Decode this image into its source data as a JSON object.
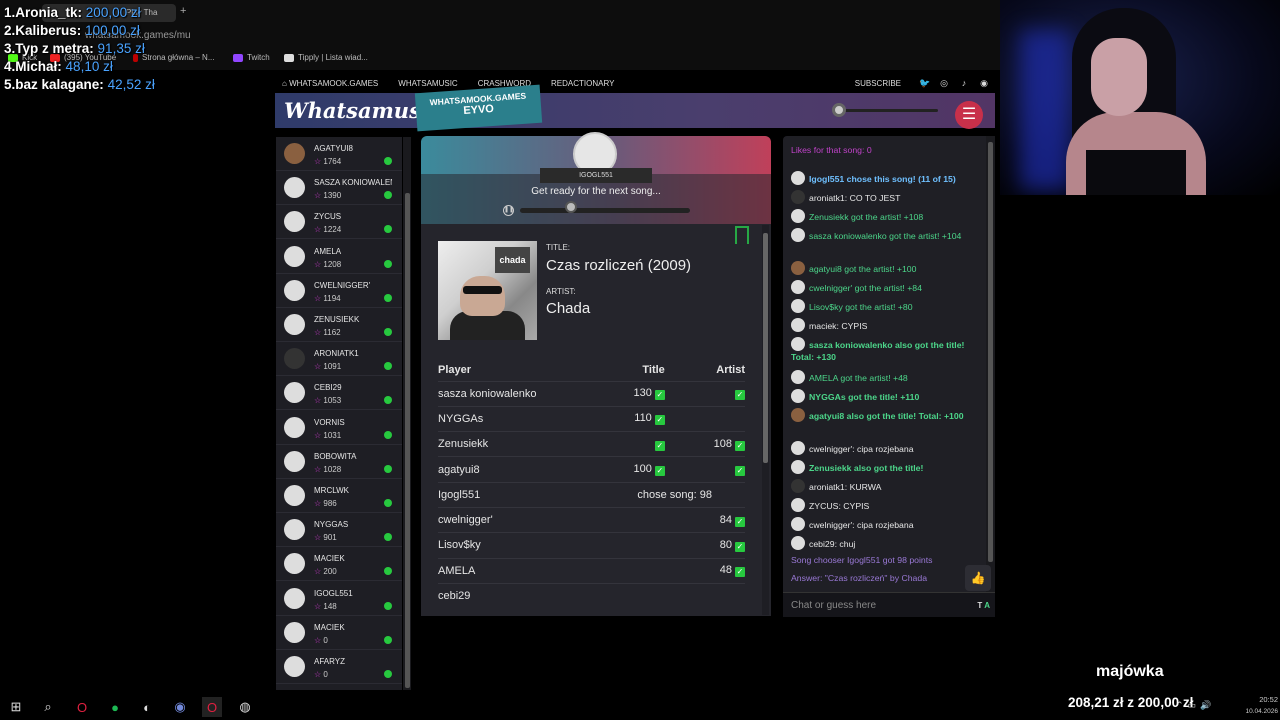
{
  "browser": {
    "tab_label": "Play Tha",
    "url": "whatsamook.games/mu",
    "bookmarks": [
      "Kick",
      "(395) YouTube",
      "Strona główna – N...",
      "Twitch",
      "Tipply | Lista wiad..."
    ]
  },
  "donations": [
    {
      "rank": "1.",
      "name": "Aronia_tk:",
      "amount": "200,00 zł"
    },
    {
      "rank": "2.",
      "name": "Kaliberus:",
      "amount": "100,00 zł"
    },
    {
      "rank": "3.",
      "name": "Typ z metra:",
      "amount": "91,35 zł"
    },
    {
      "rank": "4.",
      "name": "Michał:",
      "amount": "48,10 zł"
    },
    {
      "rank": "5.",
      "name": "baz kalagane:",
      "amount": "42,52 zł"
    }
  ],
  "sitenav": {
    "home": "WHATSAMOOK.GAMES",
    "links": [
      "WHATSAMUSIC",
      "CRASHWORD",
      "REDACTIONARY"
    ],
    "subscribe": "SUBSCRIBE",
    "social_icons": [
      "twitter-icon",
      "instagram-icon",
      "tiktok-icon",
      "discord-icon"
    ]
  },
  "header": {
    "logo": "Whatsamusic",
    "room_site": "WHATSAMOOK.GAMES",
    "room_code": "EYVO",
    "volume": 0.0
  },
  "players": [
    {
      "name": "AGATYUI8",
      "score": "1764"
    },
    {
      "name": "SASZA KONIOWALENKO",
      "score": "1390"
    },
    {
      "name": "ZYCUS",
      "score": "1224"
    },
    {
      "name": "AMELA",
      "score": "1208"
    },
    {
      "name": "CWELNIGGER'",
      "score": "1194"
    },
    {
      "name": "ZENUSIEKK",
      "score": "1162"
    },
    {
      "name": "ARONIATK1",
      "score": "1091"
    },
    {
      "name": "CEBI29",
      "score": "1053"
    },
    {
      "name": "VORNIS",
      "score": "1031"
    },
    {
      "name": "BOBOWITA",
      "score": "1028"
    },
    {
      "name": "MRCLWK",
      "score": "986"
    },
    {
      "name": "NYGGAS",
      "score": "901"
    },
    {
      "name": "MACIEK",
      "score": "200"
    },
    {
      "name": "IGOGL551",
      "score": "148"
    },
    {
      "name": "MACIEK",
      "score": "0"
    },
    {
      "name": "AFARYZ",
      "score": "0"
    }
  ],
  "round": {
    "chooser": "IGOGL551",
    "status": "Get ready for the next song...",
    "progress": 0.3,
    "title_label": "TITLE:",
    "title": "Czas rozliczeń (2009)",
    "artist_label": "ARTIST:",
    "artist": "Chada",
    "cover_text": "chada"
  },
  "scoreboard": {
    "headers": [
      "Player",
      "Title",
      "Artist"
    ],
    "rows": [
      {
        "player": "sasza koniowalenko",
        "title": "130",
        "title_ok": true,
        "artist": "",
        "artist_ok": true
      },
      {
        "player": "NYGGAs",
        "title": "110",
        "title_ok": true,
        "artist": "",
        "artist_ok": false
      },
      {
        "player": "Zenusiekk",
        "title": "",
        "title_ok": true,
        "artist": "108",
        "artist_ok": true
      },
      {
        "player": "agatyui8",
        "title": "100",
        "title_ok": true,
        "artist": "",
        "artist_ok": true
      },
      {
        "player": "Igogl551",
        "title": "chose song: 98",
        "title_ok": false,
        "artist": "",
        "artist_ok": false,
        "span": true
      },
      {
        "player": "cwelnigger'",
        "title": "",
        "title_ok": false,
        "artist": "84",
        "artist_ok": true
      },
      {
        "player": "Lisov$ky",
        "title": "",
        "title_ok": false,
        "artist": "80",
        "artist_ok": true
      },
      {
        "player": "AMELA",
        "title": "",
        "title_ok": false,
        "artist": "48",
        "artist_ok": true
      },
      {
        "player": "cebi29",
        "title": "",
        "title_ok": false,
        "artist": "",
        "artist_ok": false
      }
    ]
  },
  "chat": {
    "messages": [
      {
        "text": "Likes for that song: 0",
        "style": "p",
        "avatar": false
      },
      {
        "text": "Igogl551 chose this song! (11 of 15)",
        "style": "bl",
        "avatar": true
      },
      {
        "text": "aroniatk1: CO TO JEST",
        "style": "w",
        "avatar": true
      },
      {
        "text": "Zenusiekk got the artist! +108",
        "style": "g",
        "avatar": true
      },
      {
        "text": "sasza koniowalenko got the artist! +104",
        "style": "g",
        "avatar": true
      },
      {
        "text": "agatyui8 got the artist! +100",
        "style": "g",
        "avatar": true
      },
      {
        "text": "cwelnigger' got the artist! +84",
        "style": "g",
        "avatar": true
      },
      {
        "text": "Lisov$ky got the artist! +80",
        "style": "g",
        "avatar": true
      },
      {
        "text": "maciek: CYPIS",
        "style": "w",
        "avatar": true
      },
      {
        "text": "sasza koniowalenko also got the title! Total: +130",
        "style": "gb",
        "avatar": true
      },
      {
        "text": "AMELA got the artist! +48",
        "style": "g",
        "avatar": true
      },
      {
        "text": "NYGGAs got the title! +110",
        "style": "gb",
        "avatar": true
      },
      {
        "text": "agatyui8 also got the title! Total: +100",
        "style": "gb",
        "avatar": true
      },
      {
        "text": "cwelnigger': cipa rozjebana",
        "style": "w",
        "avatar": true
      },
      {
        "text": "Zenusiekk also got the title!",
        "style": "gb",
        "avatar": true
      },
      {
        "text": "aroniatk1: KURWA",
        "style": "w",
        "avatar": true
      },
      {
        "text": "ZYCUS: CYPIS",
        "style": "w",
        "avatar": true
      },
      {
        "text": "cwelnigger': cipa rozjebana",
        "style": "w",
        "avatar": true
      },
      {
        "text": "cebi29: chuj",
        "style": "w",
        "avatar": true
      },
      {
        "text": "Song chooser Igogl551 got 98 points",
        "style": "pu",
        "avatar": false
      },
      {
        "text": "Answer: \"Czas rozliczeń\" by Chada",
        "style": "pu",
        "avatar": false
      }
    ],
    "input_placeholder": "Chat or guess here",
    "input_mode_t": "T",
    "input_mode_a": "A"
  },
  "stream": {
    "title": "majówka",
    "goal": "208,21 zł z 200,00 zł"
  },
  "taskbar": {
    "time": "20:52",
    "date": "10.04.2026"
  }
}
